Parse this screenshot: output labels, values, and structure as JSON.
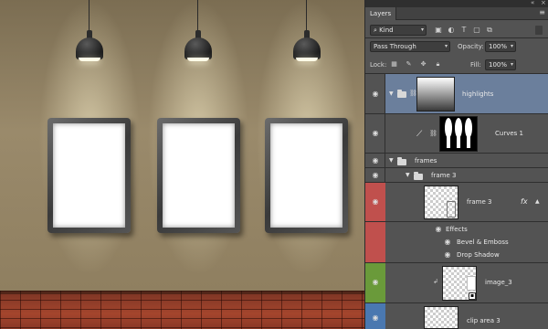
{
  "canvas": {
    "lamps": [
      {
        "id": "lamp-1"
      },
      {
        "id": "lamp-2"
      },
      {
        "id": "lamp-3"
      }
    ],
    "frames": [
      {
        "id": "frame-1"
      },
      {
        "id": "frame-2"
      },
      {
        "id": "frame-3"
      }
    ],
    "colors": {
      "wall": "#8c7c5f",
      "floor": "#a4452d",
      "frame": "#4a4a4a",
      "light": "#fff6d2"
    }
  },
  "panel": {
    "tab_label": "Layers",
    "filter": {
      "kind_label": "Kind",
      "icons": [
        "image-filter-icon",
        "adjustment-filter-icon",
        "type-filter-icon",
        "shape-filter-icon",
        "smart-object-filter-icon"
      ]
    },
    "blend_mode": "Pass Through",
    "opacity_label": "Opacity:",
    "opacity_value": "100%",
    "lock_label": "Lock:",
    "fill_label": "Fill:",
    "fill_value": "100%",
    "lock_icons": [
      "lock-transparent-icon",
      "lock-paint-icon",
      "lock-position-icon",
      "lock-all-icon"
    ]
  },
  "layers": [
    {
      "name": "highlights",
      "type": "group",
      "selected": true
    },
    {
      "name": "Curves 1",
      "type": "adjustment"
    },
    {
      "name": "frames",
      "type": "group"
    },
    {
      "name": "frame 3",
      "type": "group"
    },
    {
      "name": "frame 3",
      "type": "layer",
      "fx": "fx",
      "tag_color": "#c0504d"
    },
    {
      "name": "Effects",
      "type": "effects"
    },
    {
      "name": "Bevel & Emboss",
      "type": "effect"
    },
    {
      "name": "Drop Shadow",
      "type": "effect"
    },
    {
      "name": "image_3",
      "type": "layer",
      "tag_color": "#6a9a3a"
    },
    {
      "name": "clip area 3",
      "type": "layer",
      "tag_color": "#4a78b0"
    }
  ]
}
